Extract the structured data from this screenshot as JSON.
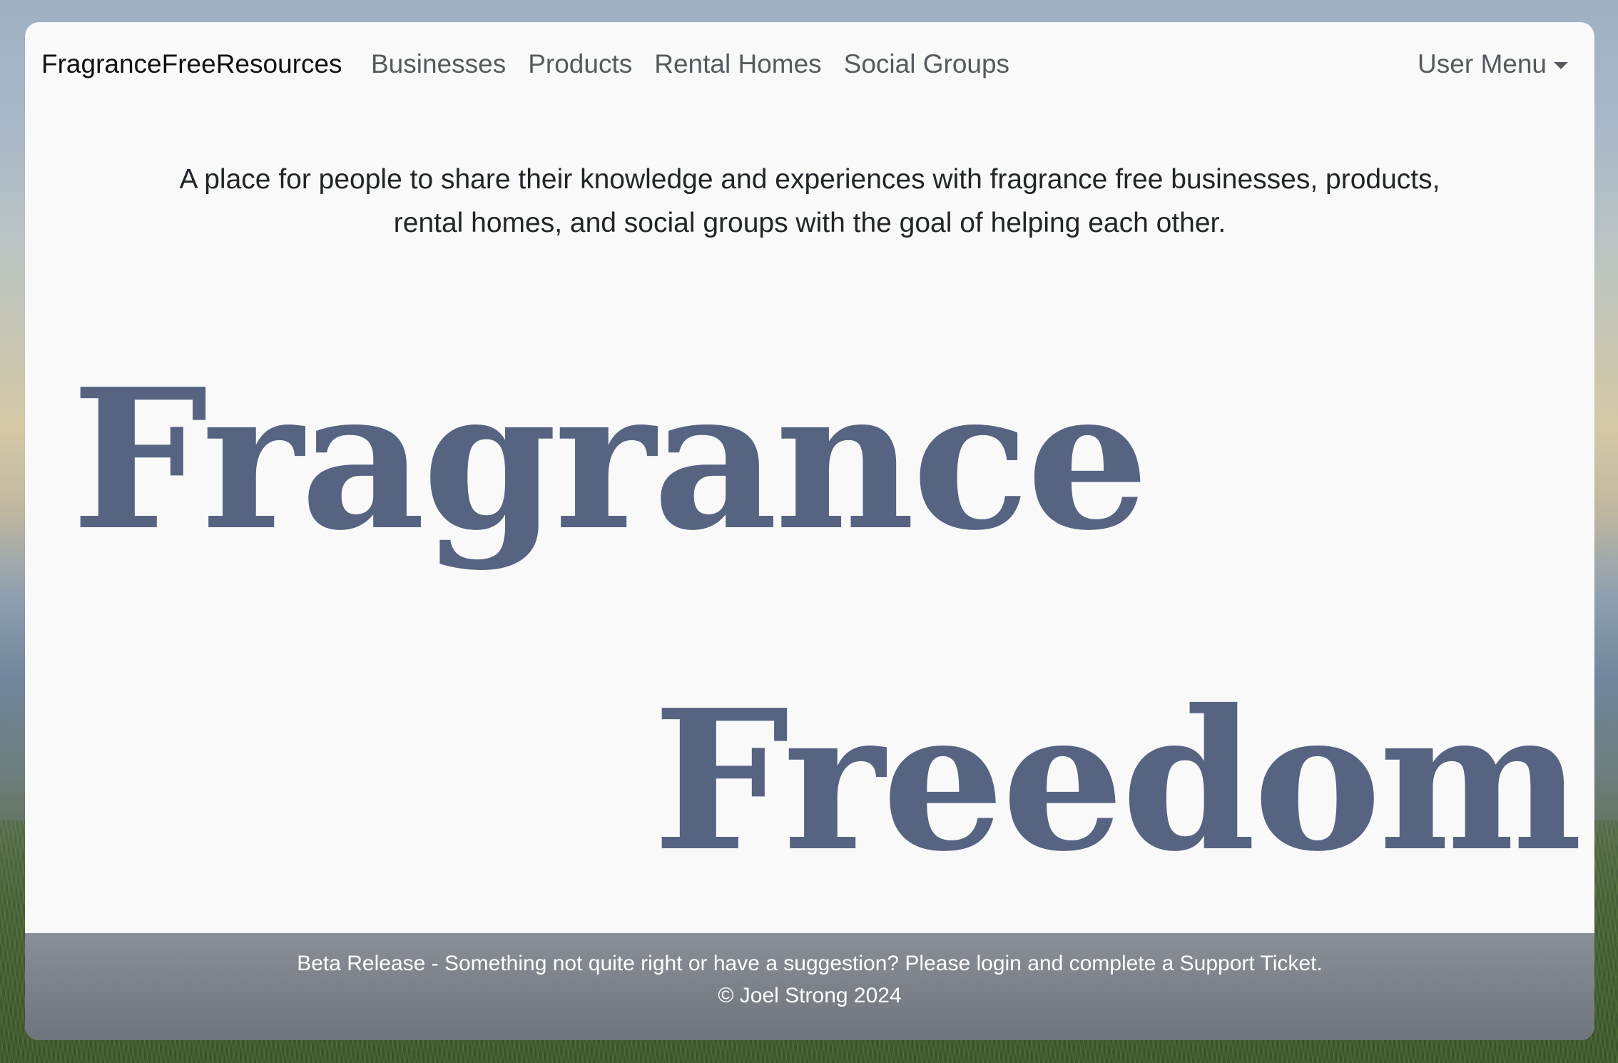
{
  "navbar": {
    "brand": "FragranceFreeResources",
    "links": [
      {
        "label": "Businesses"
      },
      {
        "label": "Products"
      },
      {
        "label": "Rental Homes"
      },
      {
        "label": "Social Groups"
      }
    ],
    "user_menu": {
      "label": "User Menu"
    }
  },
  "main": {
    "intro": "A place for people to share their knowledge and experiences with fragrance free businesses, products, rental homes, and social groups with the goal of helping each other.",
    "headline": {
      "line1": "Fragrance",
      "line2": "Freedom."
    }
  },
  "footer": {
    "beta_prefix": "Beta Release - Something not quite right or have a suggestion? Please ",
    "login_link": "login",
    "beta_middle": " and complete a ",
    "support_link": "Support Ticket",
    "beta_suffix": ".",
    "copyright": "© Joel Strong 2024"
  },
  "colors": {
    "headline": "#566482",
    "card_background": "#f9f9fa",
    "footer_background": "#7d828a",
    "nav_link": "#555a5f"
  }
}
